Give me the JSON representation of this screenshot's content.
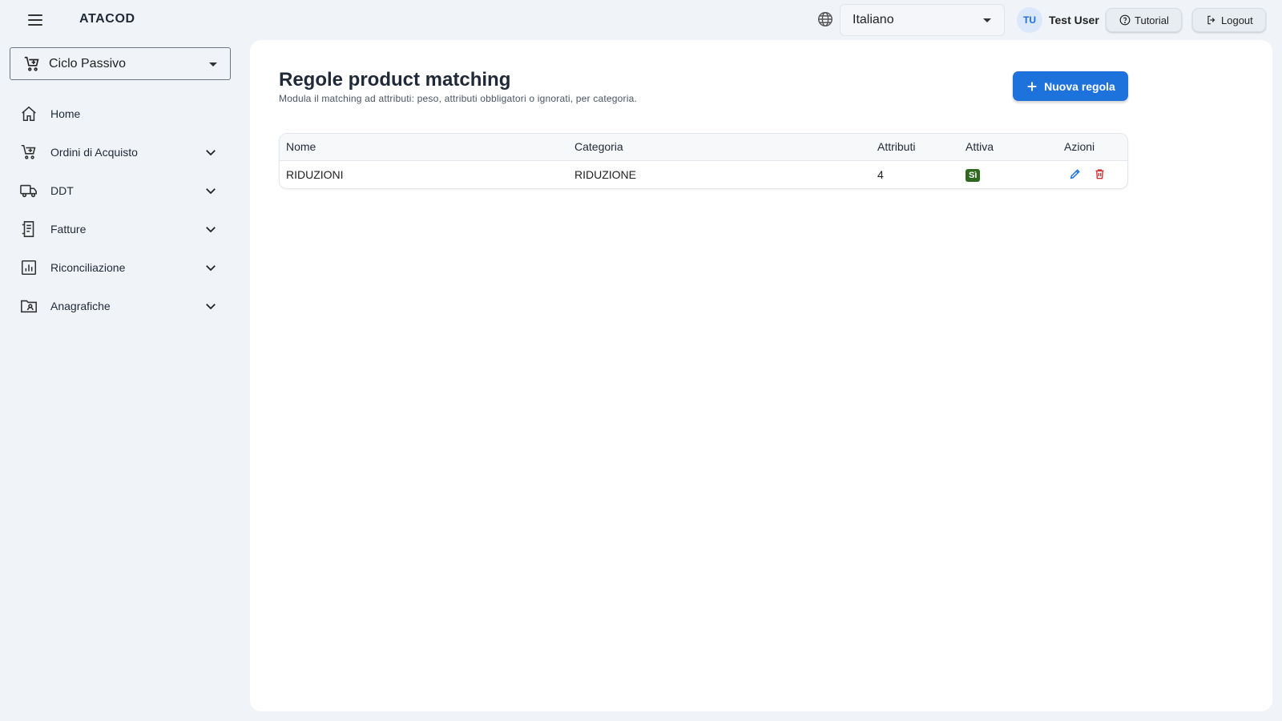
{
  "header": {
    "brand": "ATACOD",
    "language": "Italiano",
    "user_initials": "TU",
    "user_name": "Test User",
    "tutorial_label": "Tutorial",
    "logout_label": "Logout"
  },
  "sidebar": {
    "module": "Ciclo Passivo",
    "items": [
      {
        "label": "Home",
        "icon": "home-icon",
        "expandable": false
      },
      {
        "label": "Ordini di Acquisto",
        "icon": "cart-icon",
        "expandable": true
      },
      {
        "label": "DDT",
        "icon": "truck-icon",
        "expandable": true
      },
      {
        "label": "Fatture",
        "icon": "receipt-icon",
        "expandable": true
      },
      {
        "label": "Riconciliazione",
        "icon": "analytics-icon",
        "expandable": true
      },
      {
        "label": "Anagrafiche",
        "icon": "folder-user-icon",
        "expandable": true
      }
    ]
  },
  "main": {
    "title": "Regole product matching",
    "subtitle": "Modula il matching ad attributi: peso, attributi obbligatori o ignorati, per categoria.",
    "new_button_label": "Nuova regola",
    "table": {
      "columns": [
        "Nome",
        "Categoria",
        "Attributi",
        "Attiva",
        "Azioni"
      ],
      "rows": [
        {
          "nome": "RIDUZIONI",
          "categoria": "RIDUZIONE",
          "attributi": "4",
          "attiva": "Sì"
        }
      ]
    }
  },
  "colors": {
    "accent": "#1e72dc",
    "active_badge": "#2d6a1f",
    "delete": "#d32f2f",
    "background": "#f0f3f7"
  }
}
